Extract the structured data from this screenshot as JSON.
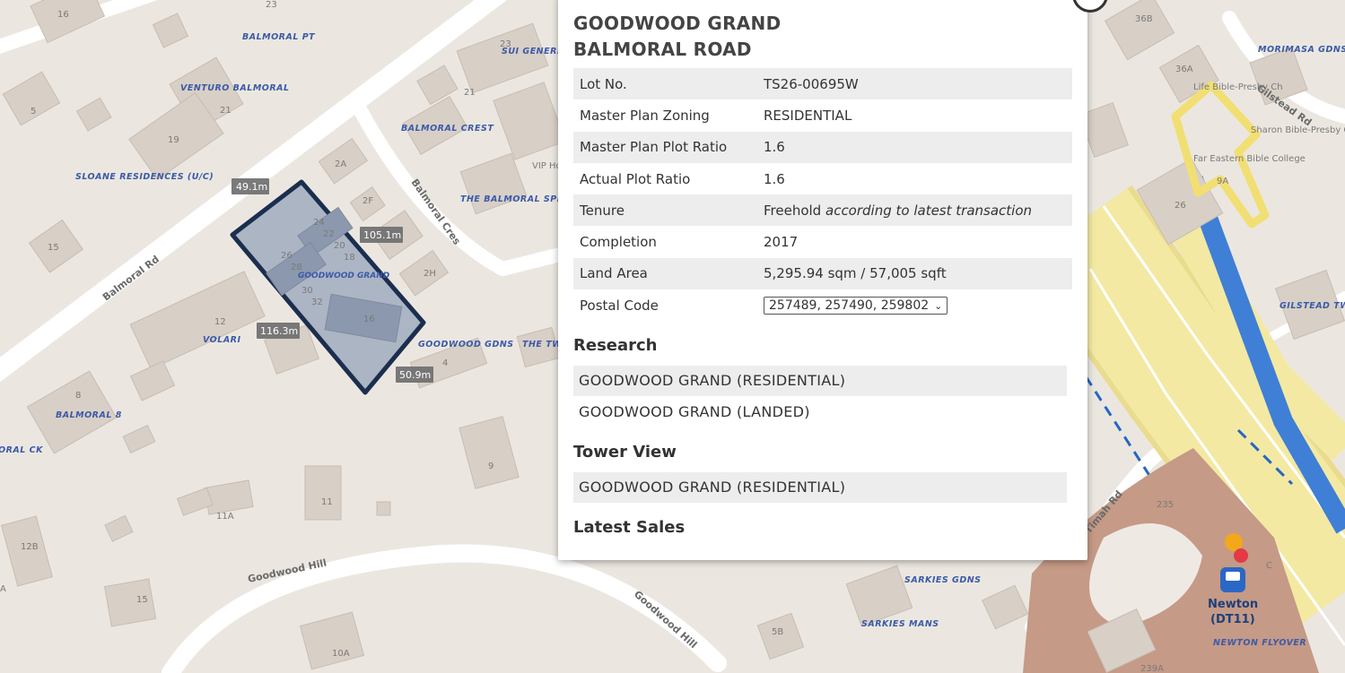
{
  "map": {
    "street_labels": [
      "Balmoral Rd",
      "Balmoral Cres",
      "Goodwood Hill",
      "Goodwood Hill",
      "Gilstead Rd",
      "Timah Rd"
    ],
    "building_numbers": [
      "16",
      "23",
      "5",
      "19",
      "21",
      "2A",
      "2F",
      "2H",
      "15",
      "12",
      "8",
      "9",
      "11",
      "11A",
      "12B",
      "15",
      "10A",
      "4",
      "21",
      "23",
      "36B",
      "36A",
      "26",
      "9A",
      "235",
      "5B",
      "239A",
      "C",
      "A"
    ],
    "place_labels": [
      "BALMORAL PT",
      "VENTURO BALMORAL",
      "SLOANE RESIDENCES (U/C)",
      "SUI GENERIS",
      "BALMORAL CREST",
      "THE BALMORAL SPRING",
      "VOLARI",
      "BALMORAL 8",
      "ORAL CK",
      "GOODWOOD GDNS",
      "THE TWINS",
      "VIP Hotel",
      "MORIMASA GDNS",
      "Life Bible-Presby Ch",
      "Sharon Bible-Presby Ch",
      "Far Eastern Bible College",
      "GILSTEAD TWO",
      "SARKIES GDNS",
      "SARKIES MANS",
      "NEWTON FLYOVER"
    ],
    "plot_label": "GOODWOOD GRAND",
    "plot_building_numbers": [
      "24",
      "22",
      "20",
      "18",
      "26",
      "28",
      "30",
      "32",
      "16"
    ],
    "measurements": [
      "49.1m",
      "105.1m",
      "116.3m",
      "50.9m"
    ],
    "station": {
      "name": "Newton",
      "code": "(DT11)"
    },
    "colors": {
      "plot_fill": "#9aa6bd",
      "plot_outline": "#1c2e4f",
      "expressway": "#f3e9a3",
      "canal": "#3f7fd6",
      "mrt_area": "#c59a86"
    }
  },
  "popup": {
    "title_line1": "GOODWOOD GRAND",
    "title_line2": "BALMORAL ROAD",
    "rows": [
      {
        "label": "Lot No.",
        "value": "TS26-00695W"
      },
      {
        "label": "Master Plan Zoning",
        "value": "RESIDENTIAL"
      },
      {
        "label": "Master Plan Plot Ratio",
        "value": "1.6"
      },
      {
        "label": "Actual Plot Ratio",
        "value": "1.6"
      },
      {
        "label": "Tenure",
        "value": "Freehold",
        "note": "according to latest transaction"
      },
      {
        "label": "Completion",
        "value": "2017"
      },
      {
        "label": "Land Area",
        "value": "5,295.94 sqm / 57,005 sqft"
      },
      {
        "label": "Postal Code",
        "value": "257489, 257490, 259802"
      }
    ],
    "research_heading": "Research",
    "research_links": [
      "GOODWOOD GRAND (RESIDENTIAL)",
      "GOODWOOD GRAND (LANDED)"
    ],
    "tower_heading": "Tower View",
    "tower_links": [
      "GOODWOOD GRAND (RESIDENTIAL)"
    ],
    "sales_heading": "Latest Sales"
  }
}
